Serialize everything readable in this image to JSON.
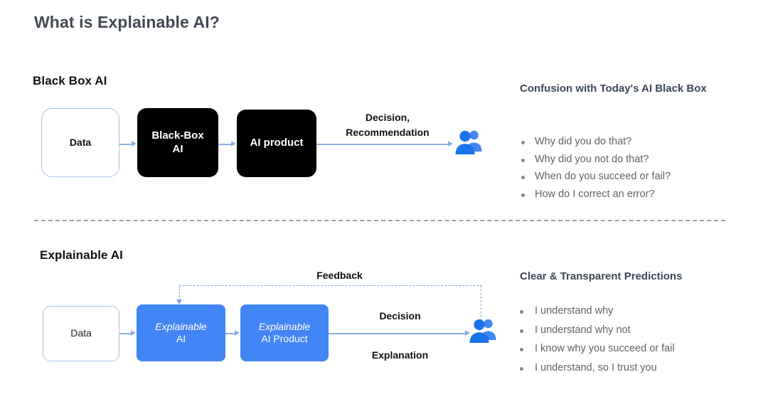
{
  "slide": {
    "title": "What is Explainable AI?"
  },
  "colors": {
    "title_text": "#434A54",
    "black_box": "#000000",
    "blue_box": "#4285F4",
    "arrow": "#8ab0dd",
    "feedback_dashed": "#7aa7dd",
    "divider": "#9aa0a6",
    "panel_heading": "#3C4858",
    "bullet_text": "#5f6368",
    "people_icon_front": "#1A73E8",
    "people_icon_back": "#4285F4"
  },
  "blackbox_section": {
    "heading": "Black Box AI",
    "boxes": {
      "data": "Data",
      "model_line1": "Black-Box",
      "model_line2": "AI",
      "product": "AI product"
    },
    "arrow_label_line1": "Decision,",
    "arrow_label_line2": "Recommendation",
    "people_icon": "people-icon"
  },
  "xai_section": {
    "heading": "Explainable AI",
    "boxes": {
      "data": "Data",
      "model_line1": "Explainable",
      "model_line2": "AI",
      "product_line1": "Explainable",
      "product_line2": "AI Product"
    },
    "arrow_label_top": "Decision",
    "arrow_label_bottom": "Explanation",
    "feedback_label": "Feedback",
    "people_icon": "people-icon"
  },
  "confusion_panel": {
    "heading": "Confusion with Today's AI Black Box",
    "bullets": [
      "Why did you do that?",
      "Why did you not do that?",
      "When do you succeed or fail?",
      "How do I correct an error?"
    ]
  },
  "clear_panel": {
    "heading": "Clear & Transparent Predictions",
    "bullets": [
      "I understand why",
      "I understand why not",
      "I know why you succeed or fail",
      "I understand, so I trust you"
    ]
  }
}
